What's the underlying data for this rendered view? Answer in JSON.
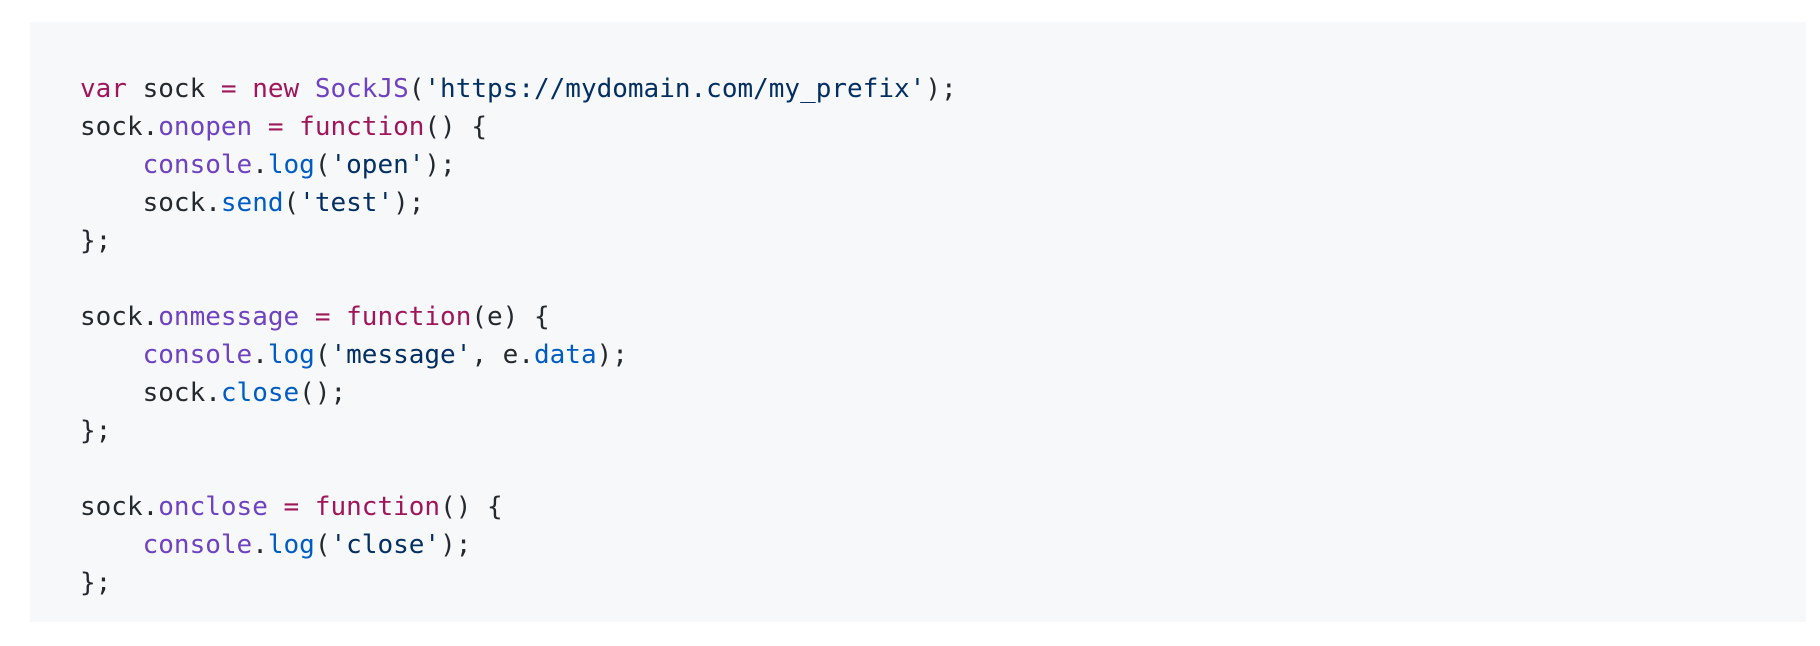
{
  "code_block": {
    "language": "javascript",
    "colors": {
      "background": "#f6f8fa",
      "keyword": "#a0165b",
      "class": "#6f42c1",
      "string": "#032f62",
      "property": "#6f42c1",
      "method": "#005cc5",
      "plain": "#24292e"
    },
    "lines": [
      [
        {
          "t": "kw",
          "v": "var"
        },
        {
          "t": "plain",
          "v": " sock "
        },
        {
          "t": "kw",
          "v": "="
        },
        {
          "t": "plain",
          "v": " "
        },
        {
          "t": "kw",
          "v": "new"
        },
        {
          "t": "plain",
          "v": " "
        },
        {
          "t": "cls",
          "v": "SockJS"
        },
        {
          "t": "plain",
          "v": "("
        },
        {
          "t": "str",
          "v": "'https://mydomain.com/my_prefix'"
        },
        {
          "t": "plain",
          "v": ");"
        }
      ],
      [
        {
          "t": "plain",
          "v": "sock."
        },
        {
          "t": "prop",
          "v": "onopen"
        },
        {
          "t": "plain",
          "v": " "
        },
        {
          "t": "kw",
          "v": "="
        },
        {
          "t": "plain",
          "v": " "
        },
        {
          "t": "kw",
          "v": "function"
        },
        {
          "t": "plain",
          "v": "() {"
        }
      ],
      [
        {
          "t": "plain",
          "v": "    "
        },
        {
          "t": "obj",
          "v": "console"
        },
        {
          "t": "plain",
          "v": "."
        },
        {
          "t": "method",
          "v": "log"
        },
        {
          "t": "plain",
          "v": "("
        },
        {
          "t": "str",
          "v": "'open'"
        },
        {
          "t": "plain",
          "v": ");"
        }
      ],
      [
        {
          "t": "plain",
          "v": "    sock."
        },
        {
          "t": "method",
          "v": "send"
        },
        {
          "t": "plain",
          "v": "("
        },
        {
          "t": "str",
          "v": "'test'"
        },
        {
          "t": "plain",
          "v": ");"
        }
      ],
      [
        {
          "t": "plain",
          "v": "};"
        }
      ],
      [
        {
          "t": "plain",
          "v": ""
        }
      ],
      [
        {
          "t": "plain",
          "v": "sock."
        },
        {
          "t": "prop",
          "v": "onmessage"
        },
        {
          "t": "plain",
          "v": " "
        },
        {
          "t": "kw",
          "v": "="
        },
        {
          "t": "plain",
          "v": " "
        },
        {
          "t": "kw",
          "v": "function"
        },
        {
          "t": "plain",
          "v": "(e) {"
        }
      ],
      [
        {
          "t": "plain",
          "v": "    "
        },
        {
          "t": "obj",
          "v": "console"
        },
        {
          "t": "plain",
          "v": "."
        },
        {
          "t": "method",
          "v": "log"
        },
        {
          "t": "plain",
          "v": "("
        },
        {
          "t": "str",
          "v": "'message'"
        },
        {
          "t": "plain",
          "v": ", e."
        },
        {
          "t": "method",
          "v": "data"
        },
        {
          "t": "plain",
          "v": ");"
        }
      ],
      [
        {
          "t": "plain",
          "v": "    sock."
        },
        {
          "t": "method",
          "v": "close"
        },
        {
          "t": "plain",
          "v": "();"
        }
      ],
      [
        {
          "t": "plain",
          "v": "};"
        }
      ],
      [
        {
          "t": "plain",
          "v": ""
        }
      ],
      [
        {
          "t": "plain",
          "v": "sock."
        },
        {
          "t": "prop",
          "v": "onclose"
        },
        {
          "t": "plain",
          "v": " "
        },
        {
          "t": "kw",
          "v": "="
        },
        {
          "t": "plain",
          "v": " "
        },
        {
          "t": "kw",
          "v": "function"
        },
        {
          "t": "plain",
          "v": "() {"
        }
      ],
      [
        {
          "t": "plain",
          "v": "    "
        },
        {
          "t": "obj",
          "v": "console"
        },
        {
          "t": "plain",
          "v": "."
        },
        {
          "t": "method",
          "v": "log"
        },
        {
          "t": "plain",
          "v": "("
        },
        {
          "t": "str",
          "v": "'close'"
        },
        {
          "t": "plain",
          "v": ");"
        }
      ],
      [
        {
          "t": "plain",
          "v": "};"
        }
      ]
    ]
  }
}
